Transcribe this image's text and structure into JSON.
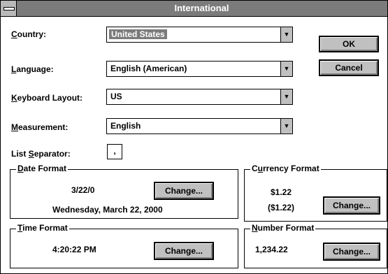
{
  "window": {
    "title": "International"
  },
  "fields": {
    "country": {
      "label_mnemonic": "C",
      "label_rest": "ountry:",
      "value": "United States"
    },
    "language": {
      "label_mnemonic": "L",
      "label_rest": "anguage:",
      "value": "English (American)"
    },
    "keyboard": {
      "label_mnemonic": "K",
      "label_rest": "eyboard Layout:",
      "value": "US"
    },
    "measurement": {
      "label_mnemonic": "M",
      "label_rest": "easurement:",
      "value": "English"
    },
    "list_separator": {
      "label_prefix": "List ",
      "label_mnemonic": "S",
      "label_rest": "eparator:",
      "value": ","
    }
  },
  "buttons": {
    "ok": "OK",
    "cancel": "Cancel",
    "change": "Change..."
  },
  "date_format": {
    "label_mnemonic": "D",
    "label_rest": "ate Format",
    "short": "3/22/0",
    "long": "Wednesday, March 22, 2000"
  },
  "time_format": {
    "label_mnemonic": "T",
    "label_rest": "ime Format",
    "value": "4:20:22 PM"
  },
  "currency_format": {
    "label_prefix": "C",
    "label_mnemonic": "u",
    "label_rest": "rrency Format",
    "positive": "$1.22",
    "negative": "($1.22)"
  },
  "number_format": {
    "label_mnemonic": "N",
    "label_rest": "umber Format",
    "value": "1,234.22"
  }
}
